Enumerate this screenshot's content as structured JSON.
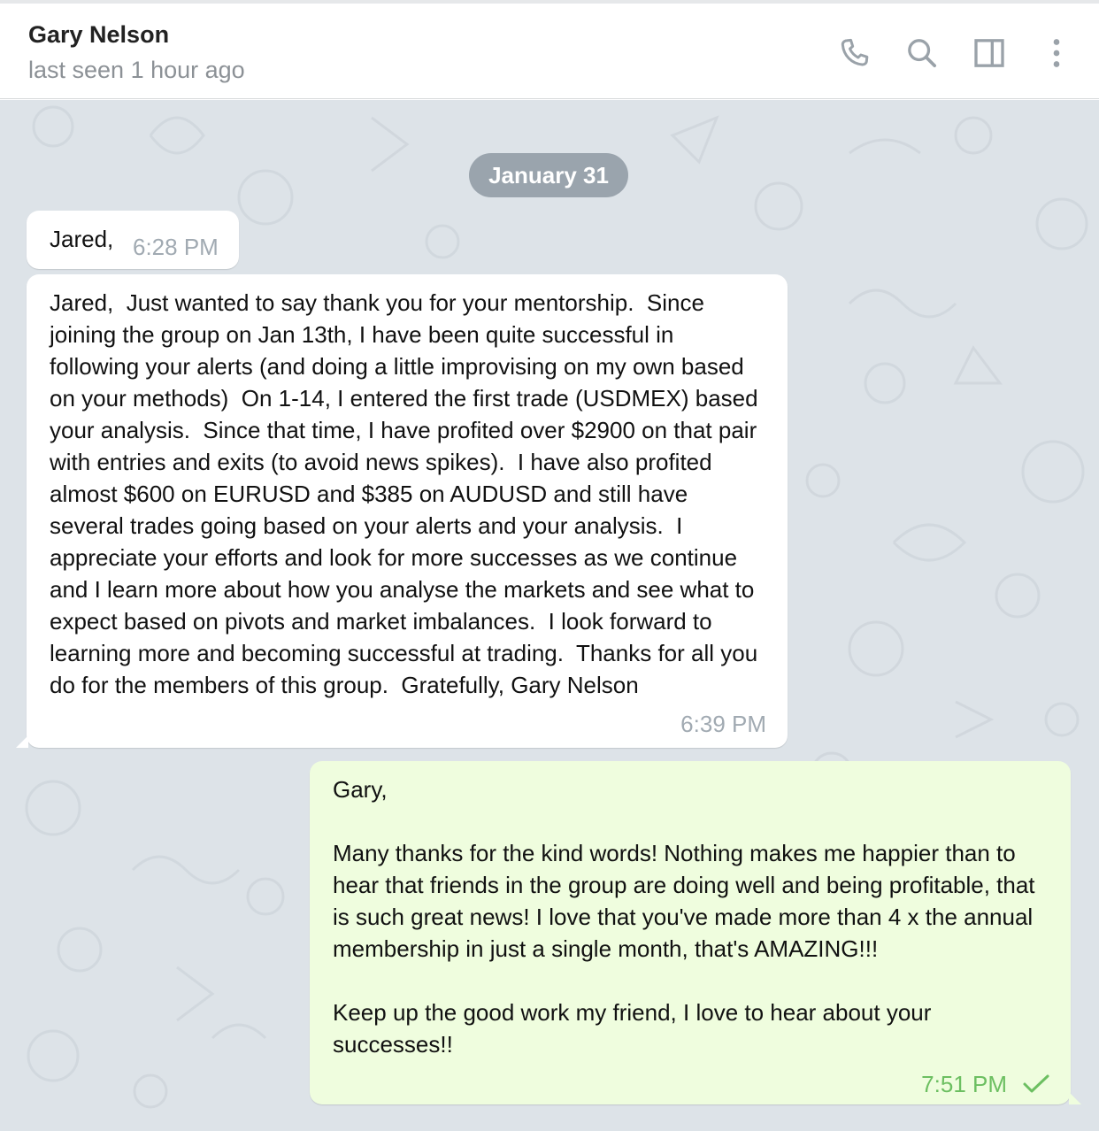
{
  "header": {
    "contact_name": "Gary Nelson",
    "status": "last seen 1 hour ago",
    "icons": [
      "phone-icon",
      "search-icon",
      "sidebar-toggle-icon",
      "more-vertical-icon"
    ]
  },
  "chat": {
    "date_separator": "January 31",
    "messages": [
      {
        "direction": "incoming",
        "text": "Jared,",
        "time": "6:28 PM"
      },
      {
        "direction": "incoming",
        "text": "Jared,  Just wanted to say thank you for your mentorship.  Since joining the group on Jan 13th, I have been quite successful in following your alerts (and doing a little improvising on my own based on your methods)  On 1-14, I entered the first trade (USDMEX) based your analysis.  Since that time, I have profited over $2900 on that pair with entries and exits (to avoid news spikes).  I have also profited almost $600 on EURUSD and $385 on AUDUSD and still have several trades going based on your alerts and your analysis.  I appreciate your efforts and look for more successes as we continue and I learn more about how you analyse the markets and see what to expect based on pivots and market imbalances.  I look forward to learning more and becoming successful at trading.  Thanks for all you do for the members of this group.  Gratefully, Gary Nelson",
        "time": "6:39 PM"
      },
      {
        "direction": "outgoing",
        "text": "Gary,\n\nMany thanks for the kind words! Nothing makes me happier than to hear that friends in the group are doing well and being profitable, that is such great news! I love that you've made more than 4 x the annual membership in just a single month, that's AMAZING!!!\n\nKeep up the good work my friend, I love to hear about your successes!!",
        "time": "7:51 PM",
        "status_icon": "check-icon"
      }
    ]
  },
  "colors": {
    "chat_background": "#dde3e8",
    "incoming_bubble": "#ffffff",
    "outgoing_bubble": "#effdde",
    "outgoing_time": "#6cbf61",
    "date_pill": "#9aa4ad"
  }
}
